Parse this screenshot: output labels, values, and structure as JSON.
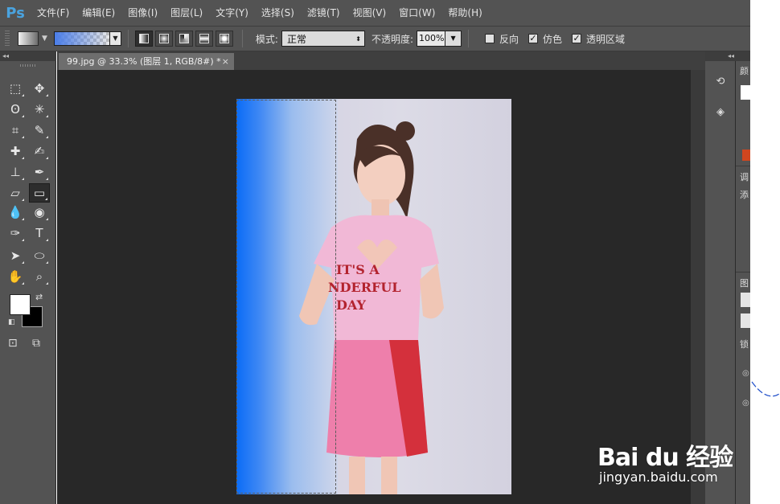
{
  "app": {
    "logo": "Ps"
  },
  "menu": [
    "文件(F)",
    "编辑(E)",
    "图像(I)",
    "图层(L)",
    "文字(Y)",
    "选择(S)",
    "滤镜(T)",
    "视图(V)",
    "窗口(W)",
    "帮助(H)"
  ],
  "options": {
    "mode_label": "模式:",
    "mode_value": "正常",
    "opacity_label": "不透明度:",
    "opacity_value": "100%",
    "reverse_label": "反向",
    "reverse_checked": false,
    "dither_label": "仿色",
    "dither_checked": true,
    "transparency_label": "透明区域",
    "transparency_checked": true,
    "gradient_colors": [
      "#4a7de8",
      "transparent"
    ]
  },
  "document": {
    "tab_title": "99.jpg @ 33.3% (图层 1, RGB/8#) *",
    "tab_close": "×"
  },
  "tools": [
    {
      "name": "marquee-tool-icon",
      "glyph": "⬚"
    },
    {
      "name": "move-tool-icon",
      "glyph": "✥"
    },
    {
      "name": "lasso-tool-icon",
      "glyph": "ʘ"
    },
    {
      "name": "magic-wand-tool-icon",
      "glyph": "✳"
    },
    {
      "name": "crop-tool-icon",
      "glyph": "⌗"
    },
    {
      "name": "eyedropper-tool-icon",
      "glyph": "✎"
    },
    {
      "name": "healing-brush-tool-icon",
      "glyph": "✚"
    },
    {
      "name": "brush-tool-icon",
      "glyph": "✍"
    },
    {
      "name": "clone-stamp-tool-icon",
      "glyph": "⊥"
    },
    {
      "name": "history-brush-tool-icon",
      "glyph": "✒"
    },
    {
      "name": "eraser-tool-icon",
      "glyph": "▱"
    },
    {
      "name": "gradient-tool-icon",
      "glyph": "▭"
    },
    {
      "name": "blur-tool-icon",
      "glyph": "💧"
    },
    {
      "name": "dodge-tool-icon",
      "glyph": "◉"
    },
    {
      "name": "pen-tool-icon",
      "glyph": "✑"
    },
    {
      "name": "text-tool-icon",
      "glyph": "T"
    },
    {
      "name": "path-selection-tool-icon",
      "glyph": "➤"
    },
    {
      "name": "ellipse-tool-icon",
      "glyph": "⬭"
    },
    {
      "name": "hand-tool-icon",
      "glyph": "✋"
    },
    {
      "name": "zoom-tool-icon",
      "glyph": "⌕"
    }
  ],
  "colors": {
    "foreground": "#ffffff",
    "background": "#000000",
    "gradient_start": "#0a6cf7"
  },
  "right_panel": {
    "tabs": [
      "颜",
      "调",
      "添",
      "图",
      "锁"
    ]
  },
  "watermark": {
    "brand": "Bai du 经验",
    "url": "jingyan.baidu.com"
  },
  "artwork": {
    "shirt_text_1": "IT'S A",
    "shirt_text_2": "NDERFUL",
    "shirt_text_3": "DAY"
  }
}
